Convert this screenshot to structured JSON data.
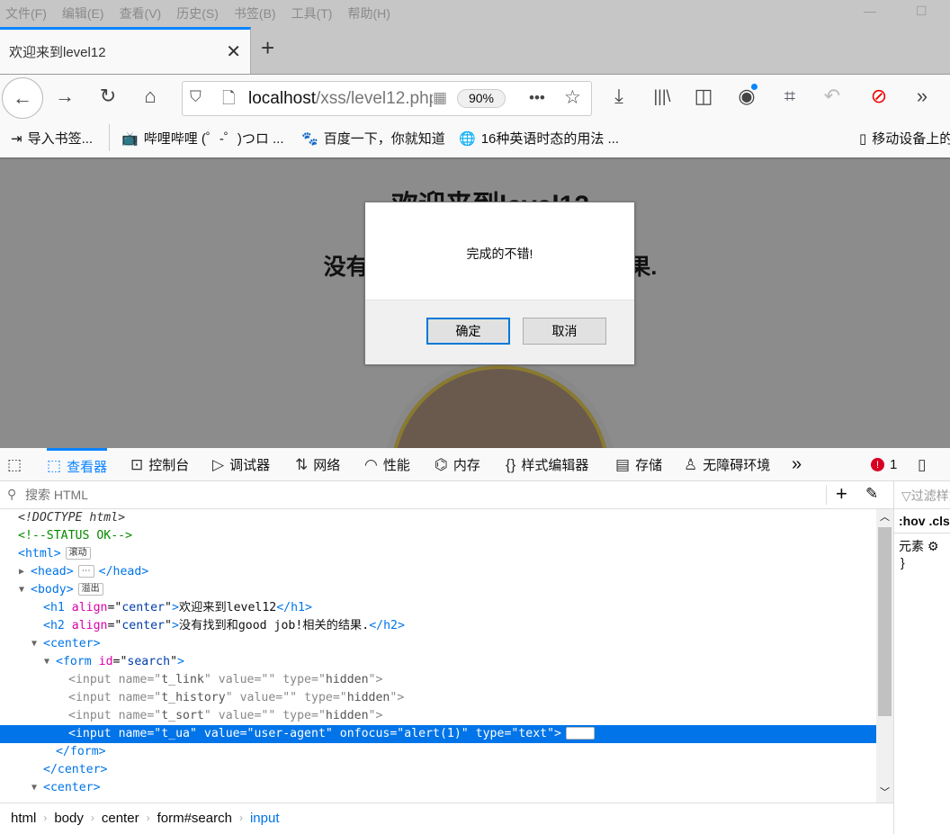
{
  "menubar": [
    "文件(F)",
    "编辑(E)",
    "查看(V)",
    "历史(S)",
    "书签(B)",
    "工具(T)",
    "帮助(H)"
  ],
  "tab": {
    "title": "欢迎来到level12"
  },
  "urlbar": {
    "host": "localhost",
    "path": "/xss/level12.php",
    "zoom": "90%"
  },
  "bookmarks": [
    "导入书签...",
    "哔哩哔哩 (゜-゜)つロ ...",
    "百度一下，你就知道",
    "16种英语时态的用法 ...",
    "移动设备上的"
  ],
  "page": {
    "h1": "欢迎来到level12",
    "h2": "没有找到和good job!相关的结果."
  },
  "dialog": {
    "message": "完成的不错!",
    "ok": "确定",
    "cancel": "取消"
  },
  "devtools": {
    "tabs": [
      "查看器",
      "控制台",
      "调试器",
      "网络",
      "性能",
      "内存",
      "样式编辑器",
      "存储",
      "无障碍环境"
    ],
    "error_count": "1",
    "search_placeholder": "搜索 HTML",
    "side": {
      "filter": "过滤样式",
      "hov": ":hov",
      ".cls": ".cls",
      "element": "元素",
      "brace": "}"
    },
    "breadcrumbs": [
      "html",
      "body",
      "center",
      "form#search",
      "input"
    ],
    "tree": [
      {
        "i": 0,
        "t": [
          [
            "dt",
            "<!DOCTYPE html>"
          ]
        ]
      },
      {
        "i": 0,
        "t": [
          [
            "cmt",
            "<!--STATUS OK-->"
          ]
        ]
      },
      {
        "i": 0,
        "t": [
          [
            "tag",
            "<html>"
          ]
        ],
        "badge": "滚动"
      },
      {
        "i": 1,
        "tw": "▶",
        "t": [
          [
            "tag",
            "<head>"
          ]
        ],
        "badge": "⋯",
        "after": [
          [
            "tag",
            "</head>"
          ]
        ]
      },
      {
        "i": 1,
        "tw": "▼",
        "t": [
          [
            "tag",
            "<body>"
          ]
        ],
        "badge": "溢出"
      },
      {
        "i": 2,
        "t": [
          [
            "tag",
            "<h1 "
          ],
          [
            "attr",
            "align"
          ],
          [
            "txt",
            "=\""
          ],
          [
            "val",
            "center"
          ],
          [
            "txt",
            "\""
          ],
          [
            "tag",
            ">"
          ],
          [
            "txt",
            "欢迎来到level12"
          ],
          [
            "tag",
            "</h1>"
          ]
        ]
      },
      {
        "i": 2,
        "t": [
          [
            "tag",
            "<h2 "
          ],
          [
            "attr",
            "align"
          ],
          [
            "txt",
            "=\""
          ],
          [
            "val",
            "center"
          ],
          [
            "txt",
            "\""
          ],
          [
            "tag",
            ">"
          ],
          [
            "txt",
            "没有找到和good job!相关的结果."
          ],
          [
            "tag",
            "</h2>"
          ]
        ]
      },
      {
        "i": 2,
        "tw": "▼",
        "t": [
          [
            "tag",
            "<center>"
          ]
        ]
      },
      {
        "i": 3,
        "tw": "▼",
        "t": [
          [
            "tag",
            "<form "
          ],
          [
            "attr",
            "id"
          ],
          [
            "txt",
            "=\""
          ],
          [
            "val",
            "search"
          ],
          [
            "txt",
            "\""
          ],
          [
            "tag",
            ">"
          ]
        ]
      },
      {
        "i": 4,
        "hid": true,
        "t": [
          [
            "tag",
            "<input "
          ],
          [
            "attr",
            "name"
          ],
          [
            "txt",
            "=\""
          ],
          [
            "val",
            "t_link"
          ],
          [
            "txt",
            "\" "
          ],
          [
            "attr",
            "value"
          ],
          [
            "txt",
            "=\"\" "
          ],
          [
            "attr",
            "type"
          ],
          [
            "txt",
            "=\""
          ],
          [
            "val",
            "hidden"
          ],
          [
            "txt",
            "\""
          ],
          [
            "tag",
            ">"
          ]
        ]
      },
      {
        "i": 4,
        "hid": true,
        "t": [
          [
            "tag",
            "<input "
          ],
          [
            "attr",
            "name"
          ],
          [
            "txt",
            "=\""
          ],
          [
            "val",
            "t_history"
          ],
          [
            "txt",
            "\" "
          ],
          [
            "attr",
            "value"
          ],
          [
            "txt",
            "=\"\" "
          ],
          [
            "attr",
            "type"
          ],
          [
            "txt",
            "=\""
          ],
          [
            "val",
            "hidden"
          ],
          [
            "txt",
            "\""
          ],
          [
            "tag",
            ">"
          ]
        ]
      },
      {
        "i": 4,
        "hid": true,
        "t": [
          [
            "tag",
            "<input "
          ],
          [
            "attr",
            "name"
          ],
          [
            "txt",
            "=\""
          ],
          [
            "val",
            "t_sort"
          ],
          [
            "txt",
            "\" "
          ],
          [
            "attr",
            "value"
          ],
          [
            "txt",
            "=\"\" "
          ],
          [
            "attr",
            "type"
          ],
          [
            "txt",
            "=\""
          ],
          [
            "val",
            "hidden"
          ],
          [
            "txt",
            "\""
          ],
          [
            "tag",
            ">"
          ]
        ]
      },
      {
        "i": 4,
        "sel": true,
        "t": [
          [
            "tag",
            "<input "
          ],
          [
            "attr",
            "name"
          ],
          [
            "txt",
            "=\""
          ],
          [
            "val",
            "t_ua"
          ],
          [
            "txt",
            "\" "
          ],
          [
            "attr",
            "value"
          ],
          [
            "txt",
            "=\""
          ],
          [
            "val",
            "user-agent"
          ],
          [
            "txt",
            "\" "
          ],
          [
            "attr",
            "onfocus"
          ],
          [
            "txt",
            "=\""
          ],
          [
            "val",
            "alert(1)"
          ],
          [
            "txt",
            "\" "
          ],
          [
            "attr",
            "type"
          ],
          [
            "txt",
            "=\""
          ],
          [
            "val",
            "text"
          ],
          [
            "txt",
            "\""
          ],
          [
            "tag",
            ">"
          ]
        ],
        "badge": "event"
      },
      {
        "i": 3,
        "t": [
          [
            "tag",
            "</form>"
          ]
        ]
      },
      {
        "i": 2,
        "t": [
          [
            "tag",
            "</center>"
          ]
        ]
      },
      {
        "i": 2,
        "tw": "▼",
        "t": [
          [
            "tag",
            "<center>"
          ]
        ]
      }
    ]
  },
  "colors": {
    "accent": "#0a84ff",
    "selection": "#0074e8",
    "overlay": "#8c8c8c"
  }
}
